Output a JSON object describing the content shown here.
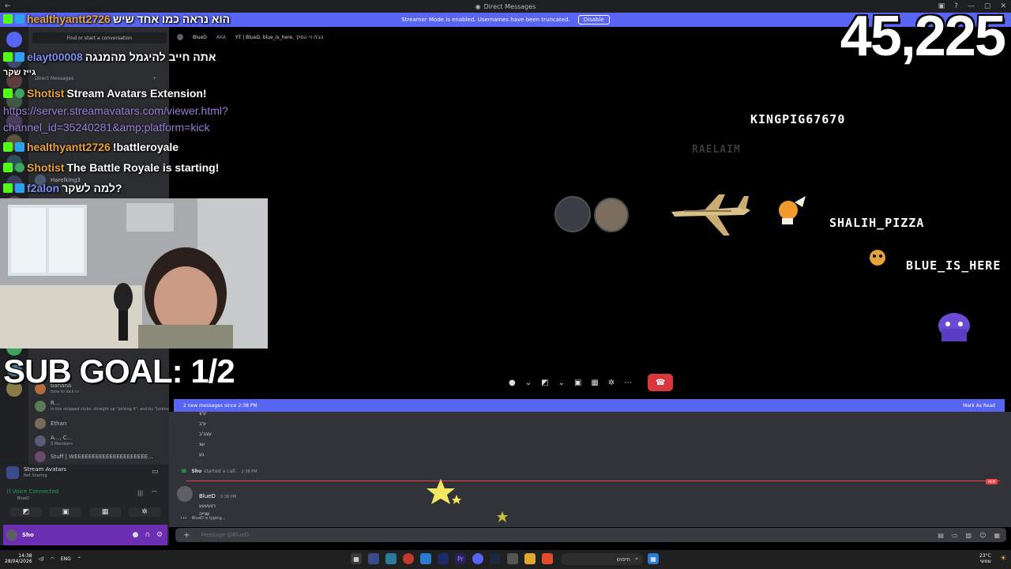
{
  "window": {
    "title": "Direct Messages"
  },
  "banner": {
    "text": "Streamer Mode is enabled. Usernames have been truncated.",
    "button": "Disable"
  },
  "sidebar": {
    "search_placeholder": "Find or start a conversation",
    "dm_header": "Direct Messages",
    "dms": [
      {
        "name": "Harelking3",
        "sub": ""
      },
      {
        "name": "banana",
        "sub": "time to lock in"
      },
      {
        "name": "R...",
        "sub": "in the stripped clubs. straight up \"jorking it\". and by \"jorking...\""
      },
      {
        "name": "Ethan",
        "sub": ""
      },
      {
        "name": "A..., C...",
        "sub": "3 Members"
      },
      {
        "name": "Stuff | WEEEEEEEEEEEEEEEEEEEEE...",
        "sub": ""
      }
    ],
    "activity": {
      "name": "Stream Avatars",
      "sub": "Not Sharing"
    },
    "voice": {
      "status": "Voice Connected",
      "sub": "BlueD"
    },
    "user": {
      "name": "Sho"
    }
  },
  "dm": {
    "recipient": "BlueD",
    "aka_label": "AKA",
    "aka": "YT | BlueD, blue_is_here, הבלו די המלך"
  },
  "call": {
    "names": [
      {
        "id": "kingpig",
        "text": "KINGPIG67670"
      },
      {
        "id": "faded",
        "text": "RAELAIM"
      },
      {
        "id": "shalih",
        "text": "SHALIH_PIZZA"
      },
      {
        "id": "blue",
        "text": "BLUE_IS_HERE"
      }
    ]
  },
  "messages": {
    "new_bar": "2 new messages since 2:38 PM",
    "mark_read": "Mark As Read",
    "history": [
      "ע'צ",
      "ע'ב",
      "עצב'ב",
      "עצ",
      "גע"
    ],
    "call_event": {
      "user": "Sho",
      "text": "started a call.",
      "time": "2:38 PM"
    },
    "new_tag": "NEW",
    "bluem": {
      "name": "BlueD",
      "time": "2:38 PM",
      "lines": [
        "רגעעעע",
        "שנייה"
      ]
    },
    "typing": "BlueD is typing...",
    "input_placeholder": "Message @BlueD"
  },
  "taskbar": {
    "time": "14:38",
    "date": "28/04/2026",
    "lang": "ENG",
    "search": "חיפוש",
    "weather": "23°C",
    "weather_sub": "שמשי"
  },
  "overlay": {
    "chat": [
      {
        "user": "healthyantt2726",
        "color": "#e8a33a",
        "msg": "הוא נראה כמו אחד שיש"
      },
      {
        "user": "elayt00008",
        "color": "#7d8cf0",
        "msg": "אתה חייב להיגמל מהמנגה"
      },
      {
        "user": "Shotist",
        "color": "#e8a33a",
        "msg": "Stream Avatars Extension!"
      },
      {
        "user": "healthyantt2726",
        "color": "#e8a33a",
        "msg": "!battleroyale"
      },
      {
        "user": "Shotist",
        "color": "#e8a33a",
        "msg": "The Battle Royale is starting!"
      },
      {
        "user": "f2alon",
        "color": "#7d8cf0",
        "msg": "למה לשקר?"
      }
    ],
    "link_line1": "https://server.streamavatars.com/viewer.html?",
    "link_line2": "channel_id=35240281&amp;platform=kick",
    "stray": "גייז שקר",
    "subgoal": "SUB GOAL: 1/2",
    "counter": "45,225"
  }
}
